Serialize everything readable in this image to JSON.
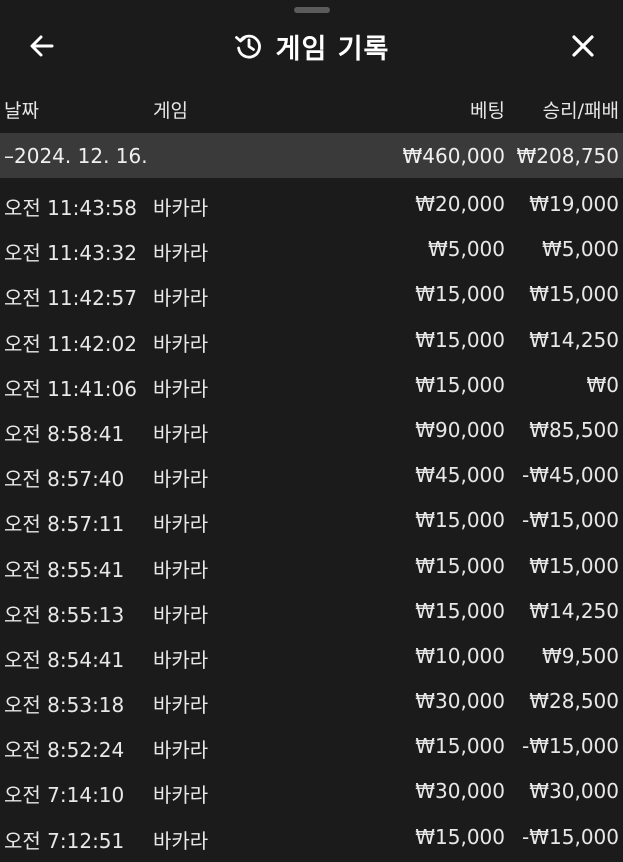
{
  "header": {
    "title": "게임 기록"
  },
  "columns": {
    "date": "날짜",
    "game": "게임",
    "bet": "베팅",
    "result": "승리/패배"
  },
  "group": {
    "date": "–2024. 12. 16.",
    "bet": "₩460,000",
    "result": "₩208,750"
  },
  "rows": [
    {
      "time": "오전 11:43:58",
      "game": "바카라",
      "bet": "₩20,000",
      "result": "₩19,000"
    },
    {
      "time": "오전 11:43:32",
      "game": "바카라",
      "bet": "₩5,000",
      "result": "₩5,000"
    },
    {
      "time": "오전 11:42:57",
      "game": "바카라",
      "bet": "₩15,000",
      "result": "₩15,000"
    },
    {
      "time": "오전 11:42:02",
      "game": "바카라",
      "bet": "₩15,000",
      "result": "₩14,250"
    },
    {
      "time": "오전 11:41:06",
      "game": "바카라",
      "bet": "₩15,000",
      "result": "₩0"
    },
    {
      "time": "오전 8:58:41",
      "game": "바카라",
      "bet": "₩90,000",
      "result": "₩85,500"
    },
    {
      "time": "오전 8:57:40",
      "game": "바카라",
      "bet": "₩45,000",
      "result": "-₩45,000"
    },
    {
      "time": "오전 8:57:11",
      "game": "바카라",
      "bet": "₩15,000",
      "result": "-₩15,000"
    },
    {
      "time": "오전 8:55:41",
      "game": "바카라",
      "bet": "₩15,000",
      "result": "₩15,000"
    },
    {
      "time": "오전 8:55:13",
      "game": "바카라",
      "bet": "₩15,000",
      "result": "₩14,250"
    },
    {
      "time": "오전 8:54:41",
      "game": "바카라",
      "bet": "₩10,000",
      "result": "₩9,500"
    },
    {
      "time": "오전 8:53:18",
      "game": "바카라",
      "bet": "₩30,000",
      "result": "₩28,500"
    },
    {
      "time": "오전 8:52:24",
      "game": "바카라",
      "bet": "₩15,000",
      "result": "-₩15,000"
    },
    {
      "time": "오전 7:14:10",
      "game": "바카라",
      "bet": "₩30,000",
      "result": "₩30,000"
    },
    {
      "time": "오전 7:12:51",
      "game": "바카라",
      "bet": "₩15,000",
      "result": "-₩15,000"
    }
  ]
}
